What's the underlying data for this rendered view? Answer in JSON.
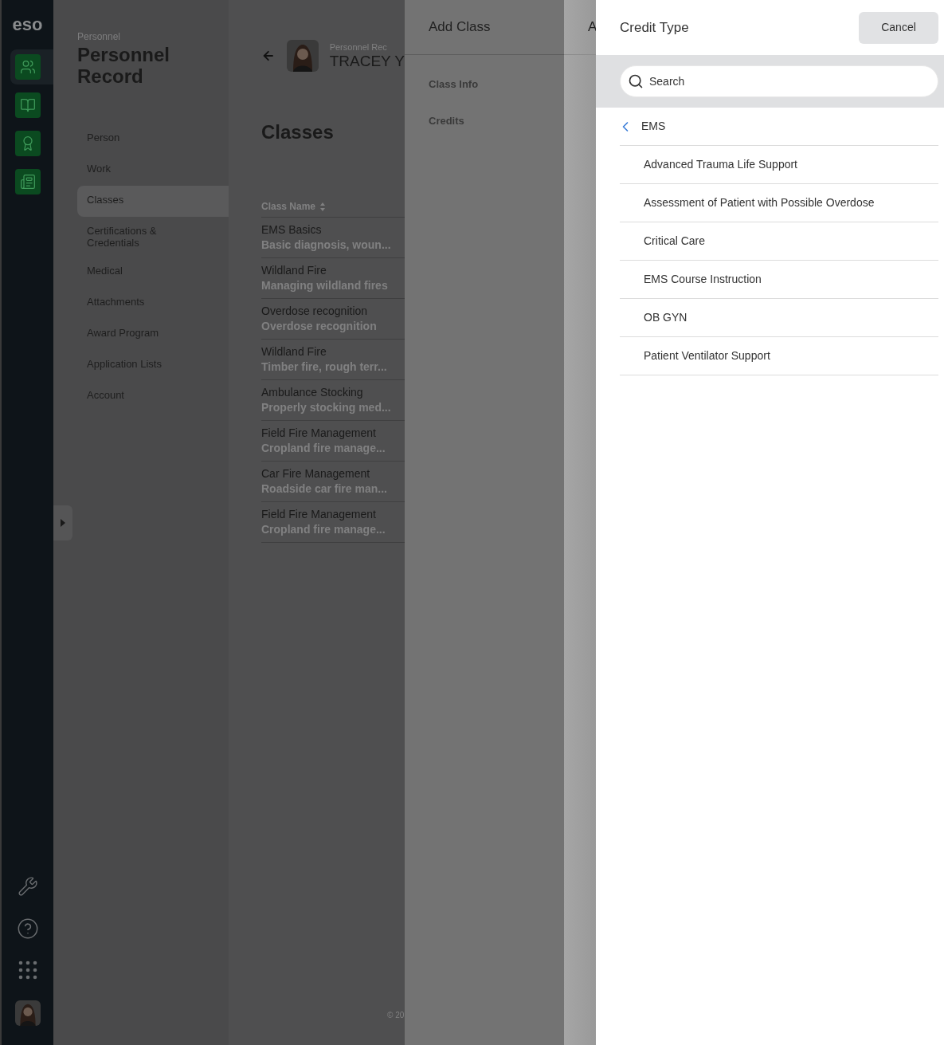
{
  "rail": {
    "logo": "eso",
    "apps": [
      {
        "selected": true
      },
      {
        "selected": false
      },
      {
        "selected": false
      },
      {
        "selected": false
      }
    ]
  },
  "nav": {
    "eyebrow": "Personnel",
    "title": "Personnel Record",
    "items": [
      {
        "label": "Person",
        "selected": false
      },
      {
        "label": "Work",
        "selected": false
      },
      {
        "label": "Classes",
        "selected": true
      },
      {
        "label": "Certifications & Credentials",
        "selected": false
      },
      {
        "label": "Medical",
        "selected": false
      },
      {
        "label": "Attachments",
        "selected": false
      },
      {
        "label": "Award Program",
        "selected": false
      },
      {
        "label": "Application Lists",
        "selected": false
      },
      {
        "label": "Account",
        "selected": false
      }
    ]
  },
  "record_header": {
    "eyebrow": "Personnel Rec",
    "name": "TRACEY Y"
  },
  "classes": {
    "title": "Classes",
    "column": "Class Name",
    "rows": [
      {
        "name": "EMS Basics",
        "description": "Basic diagnosis, woun..."
      },
      {
        "name": "Wildland Fire",
        "description": "Managing wildland fires"
      },
      {
        "name": "Overdose recognition",
        "description": "Overdose recognition"
      },
      {
        "name": "Wildland Fire",
        "description": "Timber fire, rough terr..."
      },
      {
        "name": "Ambulance Stocking",
        "description": "Properly stocking med..."
      },
      {
        "name": "Field Fire Management",
        "description": "Cropland fire manage..."
      },
      {
        "name": "Car Fire Management",
        "description": "Roadside car fire man..."
      },
      {
        "name": "Field Fire Management",
        "description": "Cropland fire manage..."
      }
    ]
  },
  "footer": "© 20",
  "add_class_panel": {
    "title": "Add Class",
    "sections": [
      "Class Info",
      "Credits"
    ]
  },
  "second_panel": {
    "title": "A"
  },
  "credit_type_panel": {
    "title": "Credit Type",
    "cancel": "Cancel",
    "search": {
      "placeholder": "Search"
    },
    "parent": "EMS",
    "items": [
      "Advanced Trauma Life Support",
      "Assessment of Patient with Possible Overdose",
      "Critical Care",
      "EMS Course Instruction",
      "OB GYN",
      "Patient Ventilator Support"
    ]
  }
}
